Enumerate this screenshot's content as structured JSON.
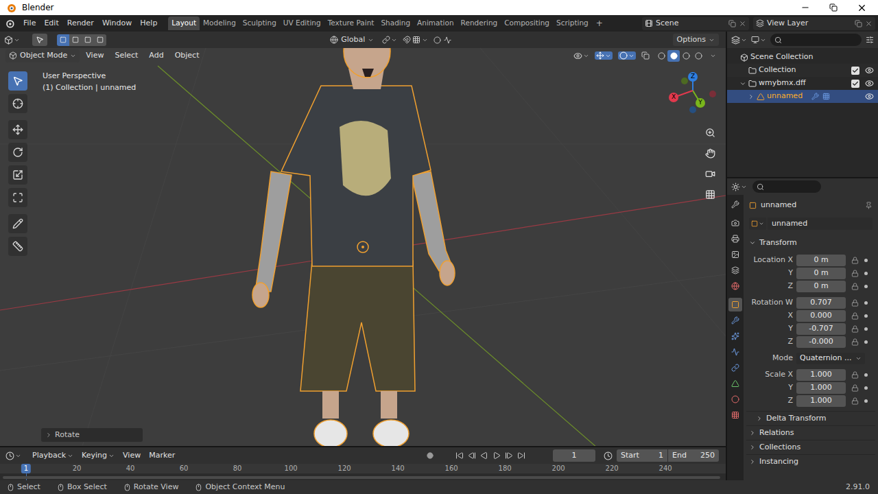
{
  "window": {
    "title": "Blender"
  },
  "menu": [
    "File",
    "Edit",
    "Render",
    "Window",
    "Help"
  ],
  "workspaces": [
    {
      "label": "Layout",
      "selected": true
    },
    {
      "label": "Modeling",
      "selected": false
    },
    {
      "label": "Sculpting",
      "selected": false
    },
    {
      "label": "UV Editing",
      "selected": false
    },
    {
      "label": "Texture Paint",
      "selected": false
    },
    {
      "label": "Shading",
      "selected": false
    },
    {
      "label": "Animation",
      "selected": false
    },
    {
      "label": "Rendering",
      "selected": false
    },
    {
      "label": "Compositing",
      "selected": false
    },
    {
      "label": "Scripting",
      "selected": false
    }
  ],
  "add_workspace": "+",
  "scene": "Scene",
  "view_layer": "View Layer",
  "viewport": {
    "select_modes": [
      {
        "selected": true
      },
      {
        "selected": false
      },
      {
        "selected": false
      },
      {
        "selected": false
      }
    ],
    "transform_orientation": "Global",
    "options": "Options",
    "mode": "Object Mode",
    "menus": [
      "View",
      "Select",
      "Add",
      "Object"
    ],
    "shading": [
      {
        "kind": "wireframe",
        "selected": false
      },
      {
        "kind": "solid",
        "selected": true
      },
      {
        "kind": "material",
        "selected": false
      },
      {
        "kind": "rendered",
        "selected": false
      }
    ],
    "view_name": "User Perspective",
    "context": "(1) Collection | unnamed",
    "last_operator": "Rotate",
    "tools": [
      {
        "kind": "select",
        "selected": true
      },
      {
        "kind": "cursor",
        "selected": false
      },
      {
        "kind": "move",
        "selected": false
      },
      {
        "kind": "rotate",
        "selected": false
      },
      {
        "kind": "scale",
        "selected": false
      },
      {
        "kind": "transform",
        "selected": false
      },
      {
        "kind": "annotate",
        "selected": false
      },
      {
        "kind": "measure",
        "selected": false
      }
    ],
    "gizmo": [
      {
        "label": "Z",
        "color": "#2f7fe0"
      },
      {
        "label": "Y",
        "color": "#7ab61c"
      },
      {
        "label": "X",
        "color": "#e2394d"
      }
    ]
  },
  "outliner": [
    {
      "label": "Scene Collection",
      "depth": 0,
      "kind": "root",
      "selected": false
    },
    {
      "label": "Collection",
      "depth": 1,
      "kind": "collection",
      "selected": false,
      "checked": true
    },
    {
      "label": "wmybmx.dff",
      "depth": 1,
      "kind": "collection",
      "expanded": true,
      "selected": false,
      "checked": true
    },
    {
      "label": "unnamed",
      "depth": 2,
      "kind": "object",
      "expanded": false,
      "selected": true
    }
  ],
  "properties": {
    "tabs": [
      {
        "kind": "tool",
        "selected": false
      },
      {
        "kind": "render",
        "selected": false
      },
      {
        "kind": "output",
        "selected": false
      },
      {
        "kind": "view_layer",
        "selected": false
      },
      {
        "kind": "scene",
        "selected": false
      },
      {
        "kind": "world",
        "selected": false
      },
      {
        "kind": "object",
        "selected": true
      },
      {
        "kind": "modifiers",
        "selected": false
      },
      {
        "kind": "particles",
        "selected": false
      },
      {
        "kind": "physics",
        "selected": false
      },
      {
        "kind": "constraints",
        "selected": false
      },
      {
        "kind": "data",
        "selected": false
      },
      {
        "kind": "material",
        "selected": false
      },
      {
        "kind": "texture",
        "selected": false
      }
    ],
    "object_name": "unnamed",
    "data_name": "unnamed",
    "transform": {
      "title": "Transform",
      "expanded": true,
      "groups": [
        [
          {
            "label": "Location X",
            "value": "0 m",
            "kind": "number"
          },
          {
            "label": "Y",
            "value": "0 m",
            "kind": "number"
          },
          {
            "label": "Z",
            "value": "0 m",
            "kind": "number"
          }
        ],
        [
          {
            "label": "Rotation W",
            "value": "0.707",
            "kind": "number"
          },
          {
            "label": "X",
            "value": "0.000",
            "kind": "number"
          },
          {
            "label": "Y",
            "value": "-0.707",
            "kind": "number"
          },
          {
            "label": "Z",
            "value": "-0.000",
            "kind": "number"
          }
        ],
        [
          {
            "label": "Mode",
            "value": "Quaternion ...",
            "kind": "dropdown"
          }
        ],
        [
          {
            "label": "Scale X",
            "value": "1.000",
            "kind": "number"
          },
          {
            "label": "Y",
            "value": "1.000",
            "kind": "number"
          },
          {
            "label": "Z",
            "value": "1.000",
            "kind": "number"
          }
        ]
      ]
    },
    "subpanels": [
      {
        "label": "Delta Transform",
        "expanded": false,
        "nested": true
      },
      {
        "label": "Relations",
        "expanded": false,
        "nested": false
      },
      {
        "label": "Collections",
        "expanded": false,
        "nested": false
      },
      {
        "label": "Instancing",
        "expanded": false,
        "nested": false
      }
    ]
  },
  "timeline": {
    "menus": [
      "Playback",
      "Keying",
      "View",
      "Marker"
    ],
    "current_frame": "1",
    "start": {
      "label": "Start",
      "value": "1"
    },
    "end": {
      "label": "End",
      "value": "250"
    },
    "playhead": "1",
    "ticks": [
      "20",
      "40",
      "60",
      "80",
      "100",
      "120",
      "140",
      "160",
      "180",
      "200",
      "220",
      "240"
    ]
  },
  "status_bar": {
    "items": [
      {
        "label": "Select"
      },
      {
        "label": "Box Select"
      },
      {
        "label": "Rotate View"
      },
      {
        "label": "Object Context Menu"
      }
    ],
    "version": "2.91.0"
  }
}
